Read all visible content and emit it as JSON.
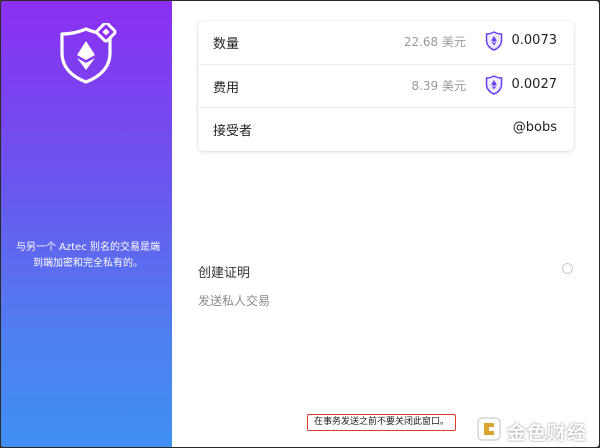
{
  "sidebar": {
    "description": "与另一个 Aztec 别名的交易是端到端加密和完全私有的。"
  },
  "summary": {
    "rows": [
      {
        "label": "数量",
        "usd": "22.68 美元",
        "amount": "0.0073"
      },
      {
        "label": "费用",
        "usd": "8.39 美元",
        "amount": "0.0027"
      },
      {
        "label": "接受者",
        "amount": "@bobs"
      }
    ]
  },
  "proof": {
    "title": "创建证明",
    "status": "发送私人交易"
  },
  "warning": "在事务发送之前不要关闭此窗口。",
  "watermark": "金色财经",
  "colors": {
    "gradient_top": "#8c2ff2",
    "gradient_bottom": "#3f90f2",
    "accent": "#6a3df0",
    "warning_border": "#e03a2f"
  },
  "icons": [
    "shield-eth-logo-icon",
    "eth-token-icon",
    "radio-icon",
    "watermark-logo-icon"
  ]
}
